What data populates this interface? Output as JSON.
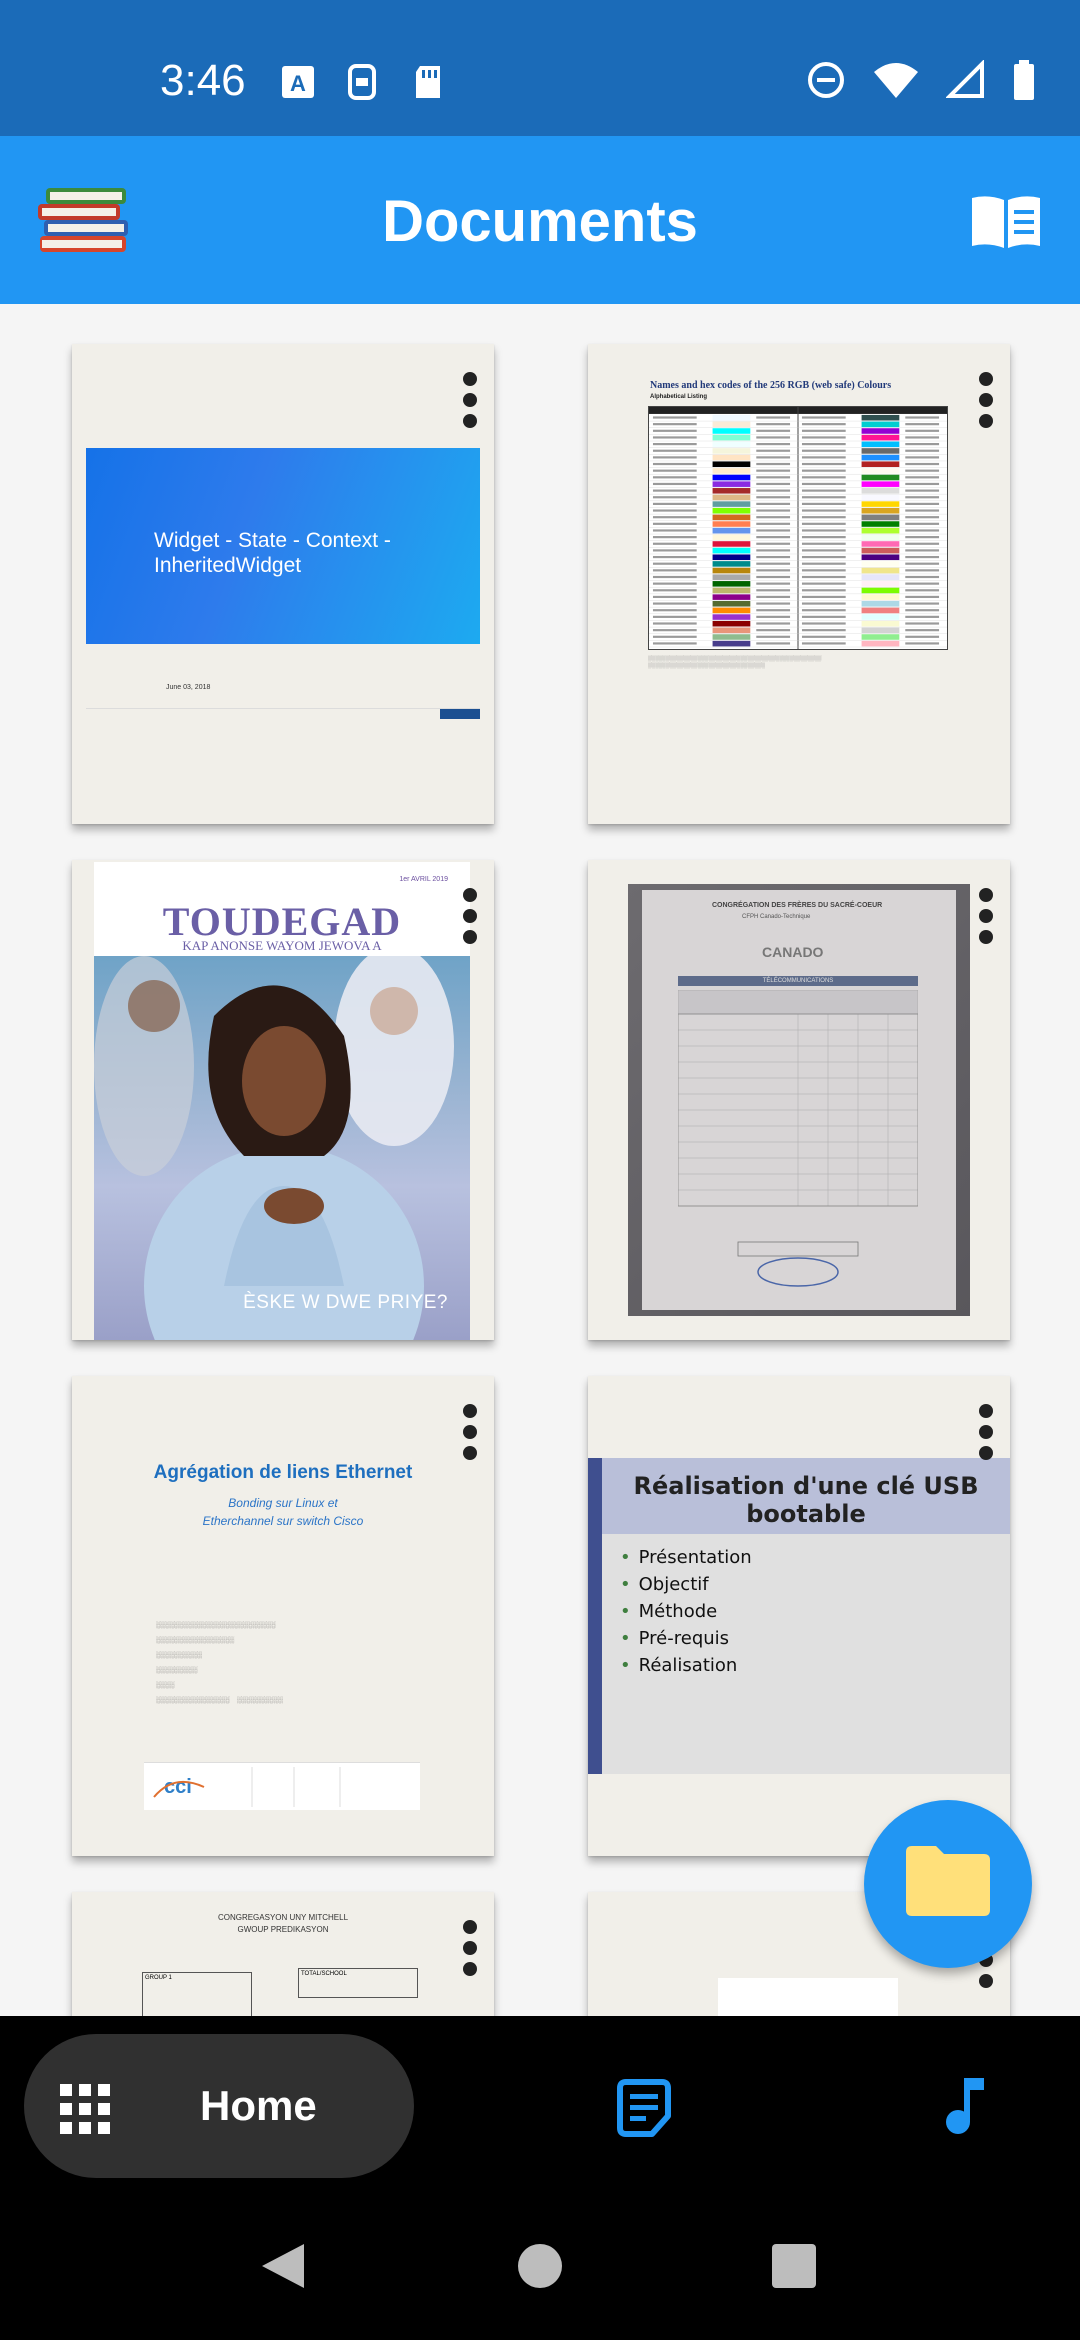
{
  "status_bar": {
    "time": "3:46"
  },
  "app_bar": {
    "title": "Documents"
  },
  "documents": [
    {
      "slide_title": "Widget - State - Context - InheritedWidget",
      "date": "June 03, 2018"
    },
    {
      "title": "Names and hex codes of the 256 RGB (web safe) Colours",
      "subtitle": "Alphabetical Listing"
    },
    {
      "date": "1er AVRIL 2019",
      "logo": "TOUDEGAD",
      "tagline": "KAP ANONSE WAYOM JEWOVA A",
      "caption": "ÈSKE W DWE PRIYE?"
    },
    {
      "header": "CONGRÉGATION DES FRÈRES DU SACRÉ-COEUR",
      "subheader": "CFPH Canado-Technique",
      "brand": "CANADO",
      "section": "TÉLÉCOMMUNICATIONS"
    },
    {
      "title": "Agrégation de liens Ethernet",
      "subtitle_line1": "Bonding sur Linux et",
      "subtitle_line2": "Etherchannel sur switch Cisco"
    },
    {
      "title": "Réalisation d'une clé USB bootable",
      "bullets": [
        "Présentation",
        "Objectif",
        "Méthode",
        "Pré-requis",
        "Réalisation"
      ]
    },
    {
      "title_line1": "CONGREGASYON UNY MITCHELL",
      "title_line2": "GWOUP PREDIKASYON",
      "box1": "GROUP 1",
      "box2": "TOTAL/SCHOOL"
    },
    {}
  ],
  "bottom_nav": {
    "home_label": "Home"
  },
  "colors": {
    "status_bar": "#1b6bb8",
    "app_bar": "#2196f3",
    "fab": "#2196f3",
    "folder": "#ffe07a"
  }
}
